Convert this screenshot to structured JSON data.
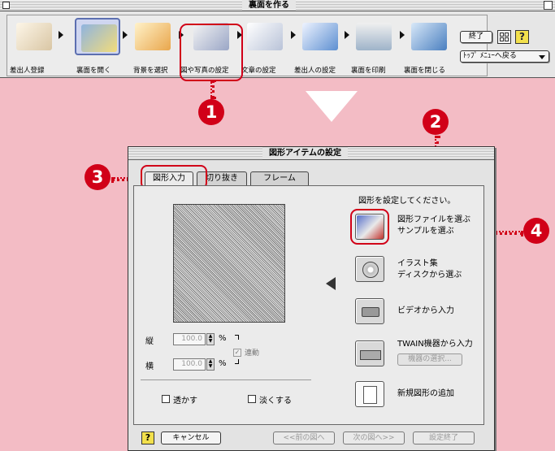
{
  "top_window": {
    "title": "裏面を作る",
    "steps": [
      {
        "label": "差出人登録",
        "icon": "sender-registration-icon"
      },
      {
        "label": "裏面を開く",
        "icon": "open-folder-icon"
      },
      {
        "label": "背景を選択",
        "icon": "background-icon"
      },
      {
        "label": "図や写真の設定",
        "icon": "image-settings-icon"
      },
      {
        "label": "文章の設定",
        "icon": "text-settings-icon"
      },
      {
        "label": "差出人の設定",
        "icon": "sender-settings-icon"
      },
      {
        "label": "裏面を印刷",
        "icon": "printer-icon"
      },
      {
        "label": "裏面を閉じる",
        "icon": "close-back-icon"
      }
    ],
    "end_button": "終了",
    "top_menu_button": "ﾄｯﾌﾟ ﾒﾆｭｰへ戻る",
    "help": "?"
  },
  "markers": [
    "1",
    "2",
    "3",
    "4"
  ],
  "dialog": {
    "title": "図形アイテムの設定",
    "tabs": [
      "図形入力",
      "切り抜き",
      "フレーム"
    ],
    "instruction": "図形を設定してください。",
    "options": [
      {
        "line1": "図形ファイルを選ぶ",
        "line2": "サンプルを選ぶ"
      },
      {
        "line1": "イラスト集",
        "line2": "ディスクから選ぶ"
      },
      {
        "line1": "ビデオから入力",
        "line2": ""
      },
      {
        "line1": "TWAIN機器から入力",
        "line2": ""
      },
      {
        "line1": "新規図形の追加",
        "line2": ""
      }
    ],
    "device_select": "機器の選択...",
    "vertical_label": "縦",
    "horizontal_label": "横",
    "vertical_value": "100.0",
    "horizontal_value": "100.0",
    "unit": "%",
    "link_label": "連動",
    "transparent_label": "透かす",
    "faint_label": "淡くする",
    "cancel": "キャンセル",
    "prev": "<<前の図へ",
    "next": "次の図へ>>",
    "finish": "設定終了",
    "help": "?"
  },
  "colors": {
    "marker": "#d10018",
    "background": "#f3bcc5"
  }
}
